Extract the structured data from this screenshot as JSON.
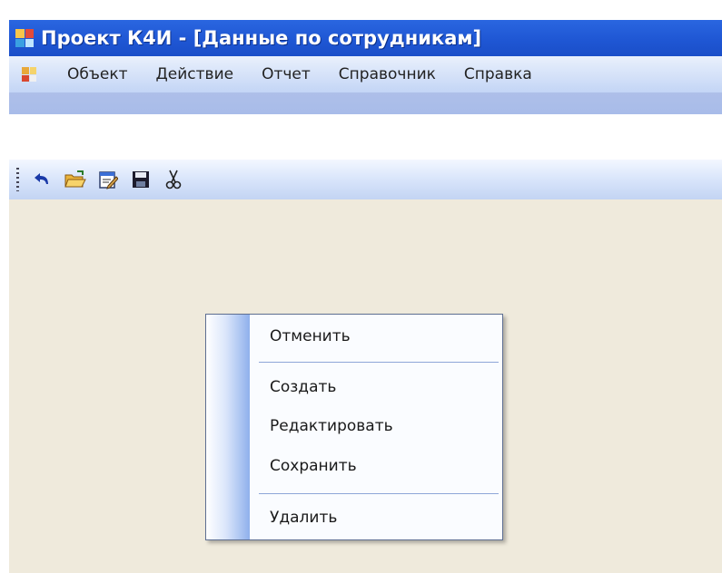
{
  "window": {
    "title": "Проект К4И - [Данные по сотрудникам]"
  },
  "menubar": {
    "items": [
      "Объект",
      "Действие",
      "Отчет",
      "Справочник",
      "Справка"
    ]
  },
  "toolbar": {
    "buttons": [
      "undo-icon",
      "open-folder-icon",
      "edit-icon",
      "save-icon",
      "cut-icon"
    ]
  },
  "context_menu": {
    "items": [
      "Отменить",
      "Создать",
      "Редактировать",
      "Сохранить",
      "Удалить"
    ]
  },
  "colors": {
    "titlebar": "#1f57d4",
    "menubar": "#c6d7f6",
    "workspace": "#efeadc",
    "menu_border": "#5e6f92"
  }
}
